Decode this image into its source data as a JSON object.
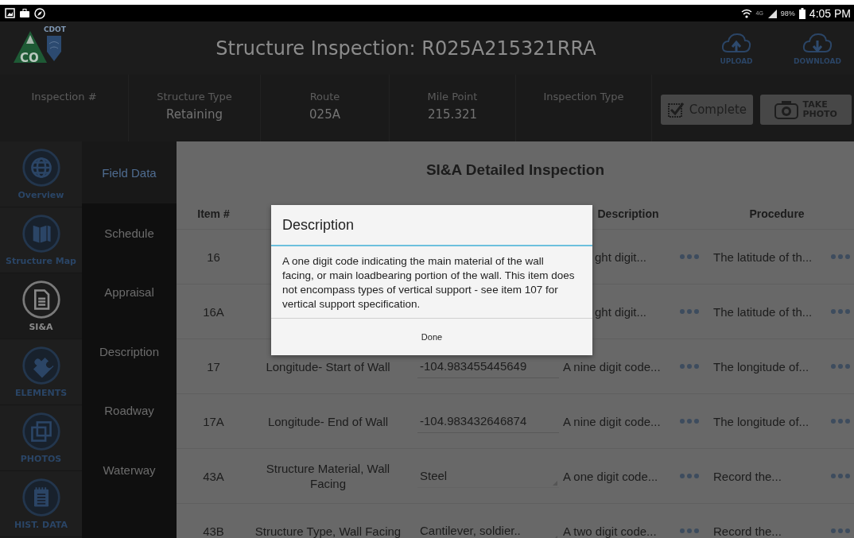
{
  "status_bar": {
    "network": "4G",
    "battery": "98%",
    "time": "4:05 PM"
  },
  "header": {
    "logo_text": "CO",
    "logo_subtext": "CDOT",
    "title": "Structure Inspection: R025A215321RRA",
    "actions": [
      {
        "label": "UPLOAD",
        "kind": "upload"
      },
      {
        "label": "DOWNLOAD",
        "kind": "download"
      }
    ]
  },
  "info_bar": {
    "fields": [
      {
        "label": "Inspection #"
      },
      {
        "label": "Structure Type",
        "value": "Retaining"
      },
      {
        "label": "Route",
        "value": "025A"
      },
      {
        "label": "Mile Point",
        "value": "215.321"
      },
      {
        "label": "Inspection Type"
      }
    ],
    "buttons": [
      {
        "label": "Complete",
        "kind": "complete"
      },
      {
        "label": "TAKE PHOTO",
        "kind": "photo"
      }
    ]
  },
  "nav": {
    "items": [
      {
        "label": "Overview",
        "kind": "globe",
        "selected": false
      },
      {
        "label": "Structure Map",
        "kind": "map",
        "selected": false
      },
      {
        "label": "SI&A",
        "kind": "document",
        "selected": true
      },
      {
        "label": "ELEMENTS",
        "kind": "puzzle",
        "selected": false
      },
      {
        "label": "PHOTOS",
        "kind": "photos",
        "selected": false
      },
      {
        "label": "HIST. DATA",
        "kind": "notepad",
        "selected": false
      }
    ]
  },
  "sections": {
    "items": [
      {
        "label": "Field Data",
        "selected": true
      },
      {
        "label": "Schedule",
        "selected": false
      },
      {
        "label": "Appraisal",
        "selected": false
      },
      {
        "label": "Description",
        "selected": false
      },
      {
        "label": "Roadway",
        "selected": false
      },
      {
        "label": "Waterway",
        "selected": false
      }
    ]
  },
  "content": {
    "title": "SI&A Detailed Inspection",
    "table": {
      "header": {
        "item": "Item #",
        "description": "Description",
        "procedure": "Procedure"
      },
      "rows": [
        {
          "item": "16",
          "description": "ght digit...",
          "procedure": "The latitude of th..."
        },
        {
          "item": "16A",
          "description": "ght digit...",
          "procedure": "The latitude of th..."
        },
        {
          "item": "17",
          "name": "Longitude- Start of Wall",
          "value": "-104.983455445649",
          "kind": "input",
          "description": "A nine digit code...",
          "procedure": "The longitude of..."
        },
        {
          "item": "17A",
          "name": "Longitude- End of Wall",
          "value": "-104.983432646874",
          "kind": "input",
          "description": "A nine digit code...",
          "procedure": "The longitude of..."
        },
        {
          "item": "43A",
          "name": "Structure Material, Wall Facing",
          "value": "Steel",
          "kind": "select",
          "description": "A one digit code...",
          "procedure": "Record the..."
        },
        {
          "item": "43B",
          "name": "Structure Type, Wall Facing",
          "value": "Cantilever, soldier..",
          "kind": "select",
          "description": "A two digit code...",
          "procedure": "Record the..."
        }
      ]
    }
  },
  "dialog": {
    "title": "Description",
    "message": "A one digit code indicating the main material of the wall facing, or main loadbearing portion of the wall. This item does not encompass types of vertical support - see item 107 for vertical support specification.",
    "button": "Done"
  }
}
